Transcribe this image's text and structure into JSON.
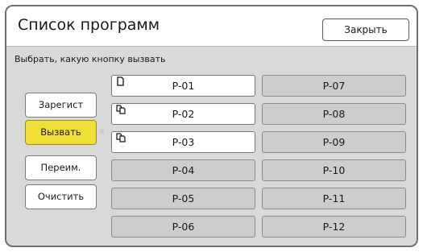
{
  "header": {
    "title": "Список программ",
    "close_label": "Закрыть"
  },
  "instruction": "Выбрать, какую кнопку вызвать",
  "side_buttons": [
    {
      "label": "Зарегист",
      "active": false
    },
    {
      "label": "Вызвать",
      "active": true
    },
    {
      "label": "Переим.",
      "active": false
    },
    {
      "label": "Очистить",
      "active": false
    }
  ],
  "programs": [
    {
      "label": "P-01",
      "filled": true,
      "icon": "single-document-icon"
    },
    {
      "label": "P-02",
      "filled": true,
      "icon": "multi-document-icon"
    },
    {
      "label": "P-03",
      "filled": true,
      "icon": "multi-document-icon"
    },
    {
      "label": "P-04",
      "filled": false
    },
    {
      "label": "P-05",
      "filled": false
    },
    {
      "label": "P-06",
      "filled": false
    },
    {
      "label": "P-07",
      "filled": false
    },
    {
      "label": "P-08",
      "filled": false
    },
    {
      "label": "P-09",
      "filled": false
    },
    {
      "label": "P-10",
      "filled": false
    },
    {
      "label": "P-11",
      "filled": false
    },
    {
      "label": "P-12",
      "filled": false
    }
  ],
  "colors": {
    "active": "#f0df35",
    "empty_slot": "#cdcdcd",
    "filled_slot": "#ffffff",
    "background": "#d9d9d9"
  }
}
